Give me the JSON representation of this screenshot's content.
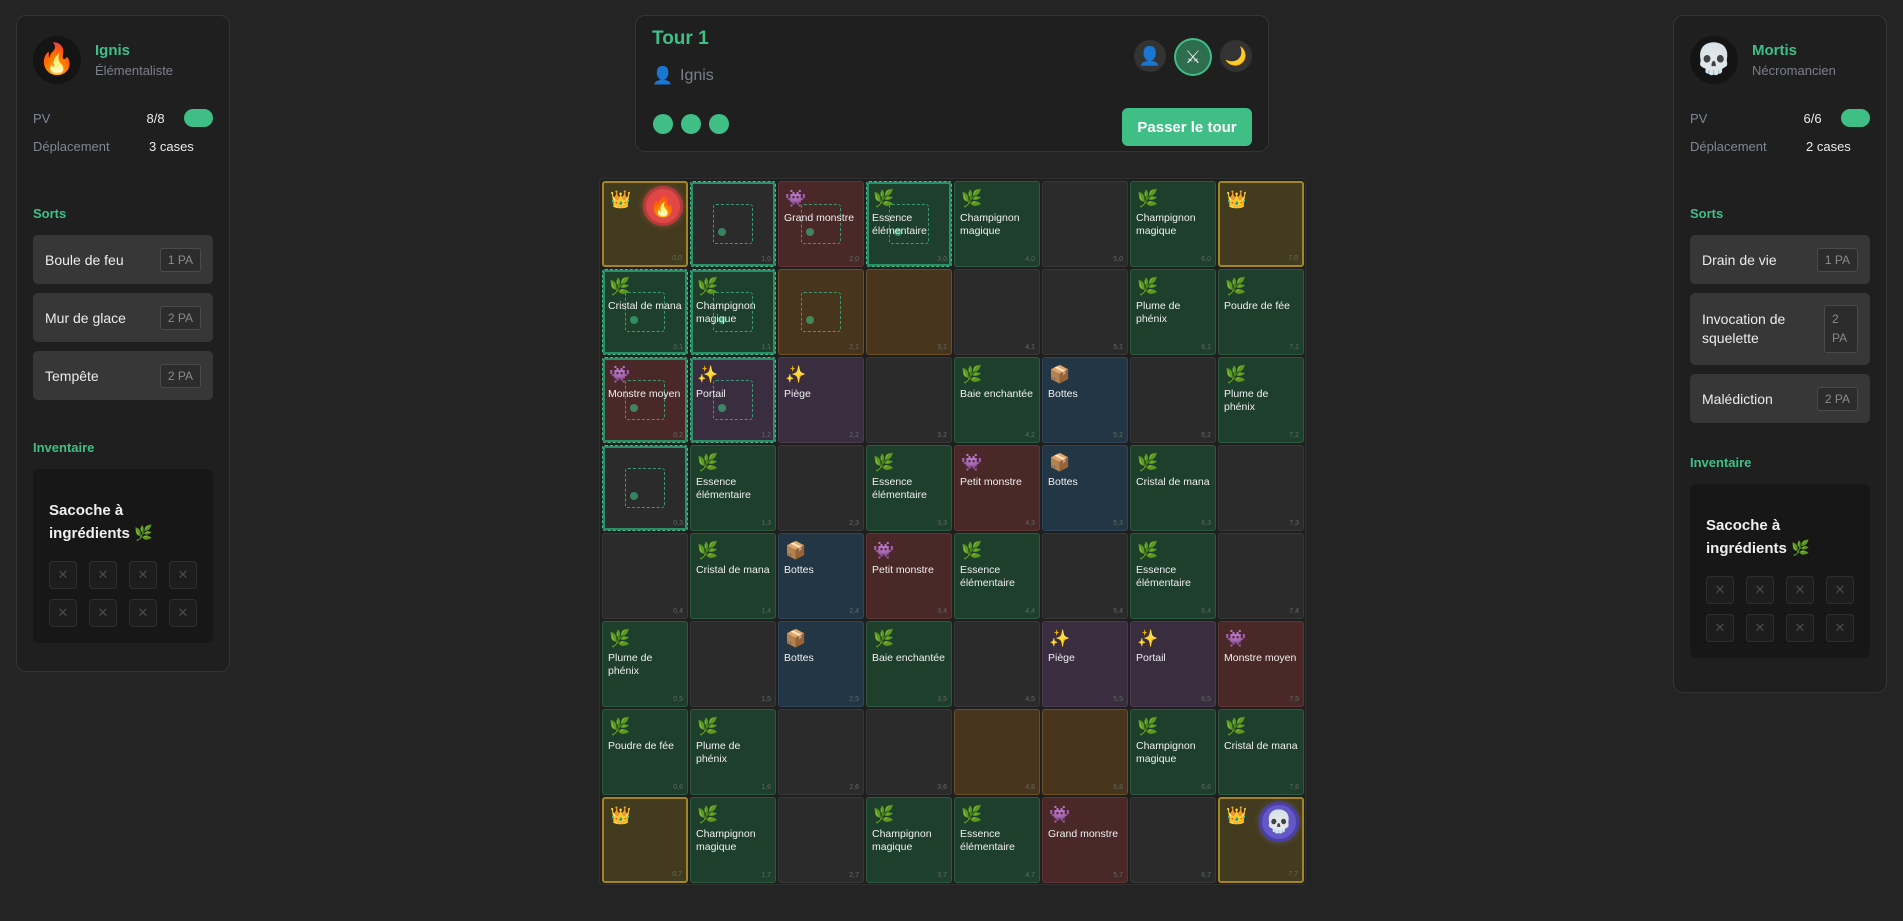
{
  "players": {
    "left": {
      "avatar_icon": "fire-icon",
      "avatar_glyph": "🔥",
      "name": "Ignis",
      "class": "Élémentaliste",
      "hp_label": "PV",
      "hp_value": "8/8",
      "move_label": "Déplacement",
      "move_value": "3 cases",
      "spells_title": "Sorts",
      "spells": [
        {
          "name": "Boule de feu",
          "cost": "1 PA"
        },
        {
          "name": "Mur de glace",
          "cost": "2 PA"
        },
        {
          "name": "Tempête",
          "cost": "2 PA"
        }
      ],
      "inventory_title": "Inventaire",
      "bag_name": "Sacoche à ingrédients 🌿",
      "slots": [
        "✕",
        "✕",
        "✕",
        "✕",
        "✕",
        "✕",
        "✕",
        "✕"
      ]
    },
    "right": {
      "avatar_icon": "skull-icon",
      "avatar_glyph": "💀",
      "name": "Mortis",
      "class": "Nécromancien",
      "hp_label": "PV",
      "hp_value": "6/6",
      "move_label": "Déplacement",
      "move_value": "2 cases",
      "spells_title": "Sorts",
      "spells": [
        {
          "name": "Drain de vie",
          "cost": "1 PA"
        },
        {
          "name": "Invocation de squelette",
          "cost": "2 PA"
        },
        {
          "name": "Malédiction",
          "cost": "2 PA"
        }
      ],
      "inventory_title": "Inventaire",
      "bag_name": "Sacoche à ingrédients 🌿",
      "slots": [
        "✕",
        "✕",
        "✕",
        "✕",
        "✕",
        "✕",
        "✕",
        "✕"
      ]
    }
  },
  "turn": {
    "title": "Tour 1",
    "current_player": "Ignis",
    "action_points_remaining": 3,
    "pass_button": "Passer le tour",
    "status_icons": [
      {
        "name": "player-icon",
        "glyph": "👤",
        "active": false
      },
      {
        "name": "crossed-swords-icon",
        "glyph": "⚔",
        "active": true
      },
      {
        "name": "moon-icon",
        "glyph": "🌙",
        "active": false
      }
    ]
  },
  "colors": {
    "accent": "#3fbf86",
    "ingredient": "#1e3f2c",
    "monster": "#4a2828",
    "item": "#233645",
    "trap": "#3a2d3f",
    "corner": "#433b1f"
  },
  "board": [
    [
      {
        "t": "corner",
        "i": "👑",
        "icon": "crown-icon",
        "token": "fire",
        "c": "0,0"
      },
      {
        "t": "empty",
        "r": true,
        "m": true,
        "c": "1,0"
      },
      {
        "t": "monster",
        "i": "👾",
        "icon": "monster-icon",
        "l": "Grand monstre",
        "m": true,
        "c": "2,0"
      },
      {
        "t": "ingredient",
        "i": "🌿",
        "icon": "herb-icon",
        "l": "Essence élémentaire",
        "r": true,
        "m": true,
        "c": "3,0"
      },
      {
        "t": "ingredient",
        "i": "🌿",
        "icon": "herb-icon",
        "l": "Champignon magique",
        "c": "4,0"
      },
      {
        "t": "empty",
        "c": "5,0"
      },
      {
        "t": "ingredient",
        "i": "🌿",
        "icon": "herb-icon",
        "l": "Champignon magique",
        "c": "6,0"
      },
      {
        "t": "corner",
        "i": "👑",
        "icon": "crown-icon",
        "c": "7,0"
      }
    ],
    [
      {
        "t": "ingredient",
        "i": "🌿",
        "icon": "herb-icon",
        "l": "Cristal de mana",
        "r": true,
        "m": true,
        "c": "0,1"
      },
      {
        "t": "ingredient",
        "i": "🌿",
        "icon": "herb-icon",
        "l": "Champignon magique",
        "r": true,
        "m": true,
        "c": "1,1"
      },
      {
        "t": "highlight",
        "m": true,
        "c": "2,1"
      },
      {
        "t": "highlight",
        "c": "3,1"
      },
      {
        "t": "empty",
        "c": "4,1"
      },
      {
        "t": "empty",
        "c": "5,1"
      },
      {
        "t": "ingredient",
        "i": "🌿",
        "icon": "herb-icon",
        "l": "Plume de phénix",
        "c": "6,1"
      },
      {
        "t": "ingredient",
        "i": "🌿",
        "icon": "herb-icon",
        "l": "Poudre de fée",
        "c": "7,1"
      }
    ],
    [
      {
        "t": "monster",
        "i": "👾",
        "icon": "monster-icon",
        "l": "Monstre moyen",
        "r": true,
        "m": true,
        "c": "0,2"
      },
      {
        "t": "trap",
        "i": "✨",
        "icon": "sparkles-icon",
        "l": "Portail",
        "r": true,
        "m": true,
        "c": "1,2"
      },
      {
        "t": "trap",
        "i": "✨",
        "icon": "sparkles-icon",
        "l": "Piège",
        "c": "2,2"
      },
      {
        "t": "empty",
        "c": "3,2"
      },
      {
        "t": "ingredient",
        "i": "🌿",
        "icon": "herb-icon",
        "l": "Baie enchantée",
        "c": "4,2"
      },
      {
        "t": "item",
        "i": "📦",
        "icon": "box-icon",
        "l": "Bottes",
        "c": "5,2"
      },
      {
        "t": "empty",
        "c": "6,2"
      },
      {
        "t": "ingredient",
        "i": "🌿",
        "icon": "herb-icon",
        "l": "Plume de phénix",
        "c": "7,2"
      }
    ],
    [
      {
        "t": "empty",
        "r": true,
        "m": true,
        "c": "0,3"
      },
      {
        "t": "ingredient",
        "i": "🌿",
        "icon": "herb-icon",
        "l": "Essence élémentaire",
        "c": "1,3"
      },
      {
        "t": "empty",
        "c": "2,3"
      },
      {
        "t": "ingredient",
        "i": "🌿",
        "icon": "herb-icon",
        "l": "Essence élémentaire",
        "c": "3,3"
      },
      {
        "t": "monster",
        "i": "👾",
        "icon": "monster-icon",
        "l": "Petit monstre",
        "c": "4,3"
      },
      {
        "t": "item",
        "i": "📦",
        "icon": "box-icon",
        "l": "Bottes",
        "c": "5,3"
      },
      {
        "t": "ingredient",
        "i": "🌿",
        "icon": "herb-icon",
        "l": "Cristal de mana",
        "c": "6,3"
      },
      {
        "t": "empty",
        "c": "7,3"
      }
    ],
    [
      {
        "t": "empty",
        "c": "0,4"
      },
      {
        "t": "ingredient",
        "i": "🌿",
        "icon": "herb-icon",
        "l": "Cristal de mana",
        "c": "1,4"
      },
      {
        "t": "item",
        "i": "📦",
        "icon": "box-icon",
        "l": "Bottes",
        "c": "2,4"
      },
      {
        "t": "monster",
        "i": "👾",
        "icon": "monster-icon",
        "l": "Petit monstre",
        "c": "3,4"
      },
      {
        "t": "ingredient",
        "i": "🌿",
        "icon": "herb-icon",
        "l": "Essence élémentaire",
        "c": "4,4"
      },
      {
        "t": "empty",
        "c": "5,4"
      },
      {
        "t": "ingredient",
        "i": "🌿",
        "icon": "herb-icon",
        "l": "Essence élémentaire",
        "c": "6,4"
      },
      {
        "t": "empty",
        "c": "7,4"
      }
    ],
    [
      {
        "t": "ingredient",
        "i": "🌿",
        "icon": "herb-icon",
        "l": "Plume de phénix",
        "c": "0,5"
      },
      {
        "t": "empty",
        "c": "1,5"
      },
      {
        "t": "item",
        "i": "📦",
        "icon": "box-icon",
        "l": "Bottes",
        "c": "2,5"
      },
      {
        "t": "ingredient",
        "i": "🌿",
        "icon": "herb-icon",
        "l": "Baie enchantée",
        "c": "3,5"
      },
      {
        "t": "empty",
        "c": "4,5"
      },
      {
        "t": "trap",
        "i": "✨",
        "icon": "sparkles-icon",
        "l": "Piège",
        "c": "5,5"
      },
      {
        "t": "trap",
        "i": "✨",
        "icon": "sparkles-icon",
        "l": "Portail",
        "c": "6,5"
      },
      {
        "t": "monster",
        "i": "👾",
        "icon": "monster-icon",
        "l": "Monstre moyen",
        "c": "7,5"
      }
    ],
    [
      {
        "t": "ingredient",
        "i": "🌿",
        "icon": "herb-icon",
        "l": "Poudre de fée",
        "c": "0,6"
      },
      {
        "t": "ingredient",
        "i": "🌿",
        "icon": "herb-icon",
        "l": "Plume de phénix",
        "c": "1,6"
      },
      {
        "t": "empty",
        "c": "2,6"
      },
      {
        "t": "empty",
        "c": "3,6"
      },
      {
        "t": "highlight",
        "c": "4,6"
      },
      {
        "t": "highlight",
        "c": "5,6"
      },
      {
        "t": "ingredient",
        "i": "🌿",
        "icon": "herb-icon",
        "l": "Champignon magique",
        "c": "6,6"
      },
      {
        "t": "ingredient",
        "i": "🌿",
        "icon": "herb-icon",
        "l": "Cristal de mana",
        "c": "7,6"
      }
    ],
    [
      {
        "t": "corner",
        "i": "👑",
        "icon": "crown-icon",
        "c": "0,7"
      },
      {
        "t": "ingredient",
        "i": "🌿",
        "icon": "herb-icon",
        "l": "Champignon magique",
        "c": "1,7"
      },
      {
        "t": "empty",
        "c": "2,7"
      },
      {
        "t": "ingredient",
        "i": "🌿",
        "icon": "herb-icon",
        "l": "Champignon magique",
        "c": "3,7"
      },
      {
        "t": "ingredient",
        "i": "🌿",
        "icon": "herb-icon",
        "l": "Essence élémentaire",
        "c": "4,7"
      },
      {
        "t": "monster",
        "i": "👾",
        "icon": "monster-icon",
        "l": "Grand monstre",
        "c": "5,7"
      },
      {
        "t": "empty",
        "c": "6,7"
      },
      {
        "t": "corner",
        "i": "👑",
        "icon": "crown-icon",
        "token": "death",
        "c": "7,7"
      }
    ]
  ]
}
